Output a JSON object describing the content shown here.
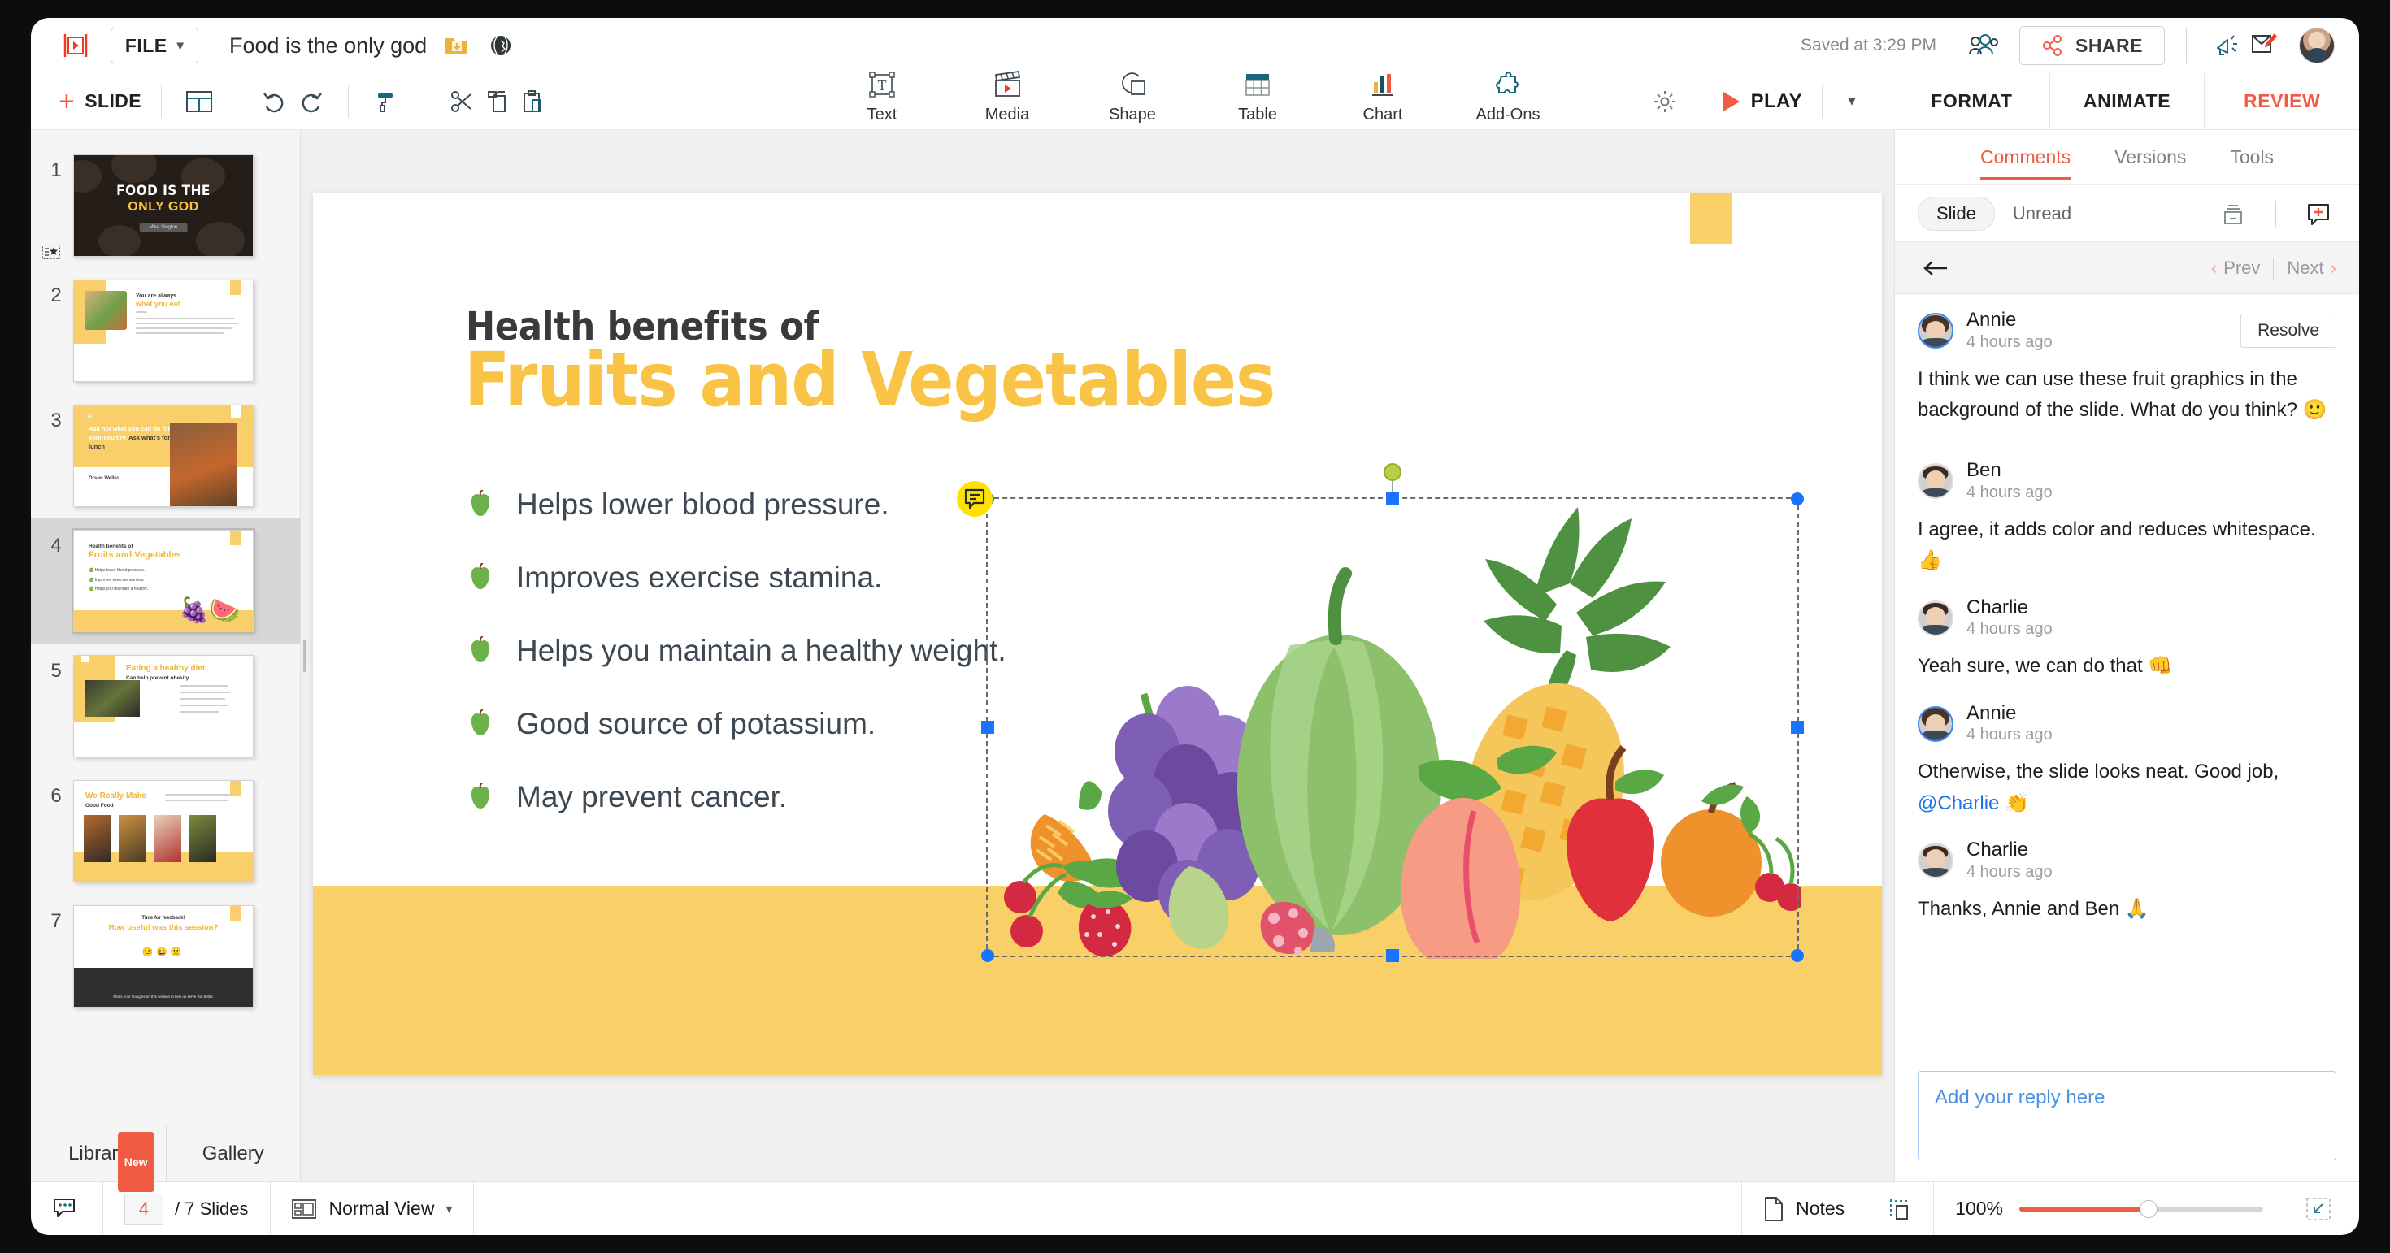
{
  "app": {
    "file_menu": "FILE",
    "document_title": "Food is the only god",
    "saved_status": "Saved at 3:29 PM",
    "share_label": "SHARE",
    "accent_red": "#ef5b43",
    "accent_yellow": "#f9c446",
    "accent_blue": "#1a73ff"
  },
  "toolbar": {
    "add_slide": "SLIDE",
    "tools": [
      {
        "label": "Text",
        "icon": "text-box-icon"
      },
      {
        "label": "Media",
        "icon": "clapperboard-icon"
      },
      {
        "label": "Shape",
        "icon": "shape-icon"
      },
      {
        "label": "Table",
        "icon": "table-icon"
      },
      {
        "label": "Chart",
        "icon": "bar-chart-icon"
      },
      {
        "label": "Add-Ons",
        "icon": "puzzle-piece-icon"
      }
    ],
    "play_label": "PLAY"
  },
  "right_tabs": [
    {
      "label": "FORMAT",
      "active": false
    },
    {
      "label": "ANIMATE",
      "active": false
    },
    {
      "label": "REVIEW",
      "active": true
    }
  ],
  "review": {
    "subtabs": [
      {
        "label": "Comments",
        "active": true
      },
      {
        "label": "Versions",
        "active": false
      },
      {
        "label": "Tools",
        "active": false
      }
    ],
    "filters": [
      {
        "label": "Slide",
        "active": true
      },
      {
        "label": "Unread",
        "active": false
      }
    ],
    "nav": {
      "prev": "Prev",
      "next": "Next"
    },
    "resolve_label": "Resolve",
    "reply_placeholder": "Add your reply here",
    "comments": [
      {
        "author": "Annie",
        "time": "4 hours ago",
        "text": "I think we can use these fruit graphics in the background of the slide. What do you think? 🙂",
        "root": true,
        "avatar": "female"
      },
      {
        "author": "Ben",
        "time": "4 hours ago",
        "text": "I agree, it adds color and reduces whitespace. 👍",
        "root": false,
        "avatar": "male-light"
      },
      {
        "author": "Charlie",
        "time": "4 hours ago",
        "text": "Yeah sure, we can do that 👊",
        "root": false,
        "avatar": "male-dark"
      },
      {
        "author": "Annie",
        "time": "4 hours ago",
        "text_before": "Otherwise, the slide looks neat. Good job, ",
        "mention": "@Charlie",
        "text_after": " 👏",
        "root": false,
        "avatar": "female"
      },
      {
        "author": "Charlie",
        "time": "4 hours ago",
        "text": "Thanks, Annie and Ben 🙏",
        "root": false,
        "avatar": "male-dark"
      }
    ]
  },
  "slides_panel": {
    "library_tab": "Library",
    "library_badge": "New",
    "gallery_tab": "Gallery",
    "thumbnails": [
      {
        "num": "1",
        "title_line1": "FOOD IS THE",
        "title_line2": "ONLY GOD",
        "author": "Mike Sington",
        "active": false
      },
      {
        "num": "2",
        "heading": "You are always",
        "subheading": "what you eat",
        "active": false
      },
      {
        "num": "3",
        "quote": "Ask not what you can do for your country. Ask what's for lunch.",
        "author": "Orson Welles",
        "active": false
      },
      {
        "num": "4",
        "heading": "Health benefits of",
        "subheading": "Fruits and Vegetables",
        "active": true
      },
      {
        "num": "5",
        "heading": "Eating a healthy diet",
        "subheading": "Can help prevent obesity",
        "active": false
      },
      {
        "num": "6",
        "heading": "We Really Make",
        "subheading": "Good Food",
        "active": false
      },
      {
        "num": "7",
        "heading": "Time for feedback!",
        "subheading": "How useful was this session?",
        "active": false
      }
    ]
  },
  "slide": {
    "title_line1": "Health benefits of",
    "title_line2": "Fruits and Vegetables",
    "bullets": [
      "Helps lower blood pressure.",
      "Improves exercise stamina.",
      "Helps you maintain a healthy weight.",
      "Good source of potassium.",
      "May prevent cancer."
    ]
  },
  "statusbar": {
    "current_slide": "4",
    "slides_total": "/ 7 Slides",
    "view_mode": "Normal View",
    "notes_label": "Notes",
    "zoom_level": "100%"
  }
}
